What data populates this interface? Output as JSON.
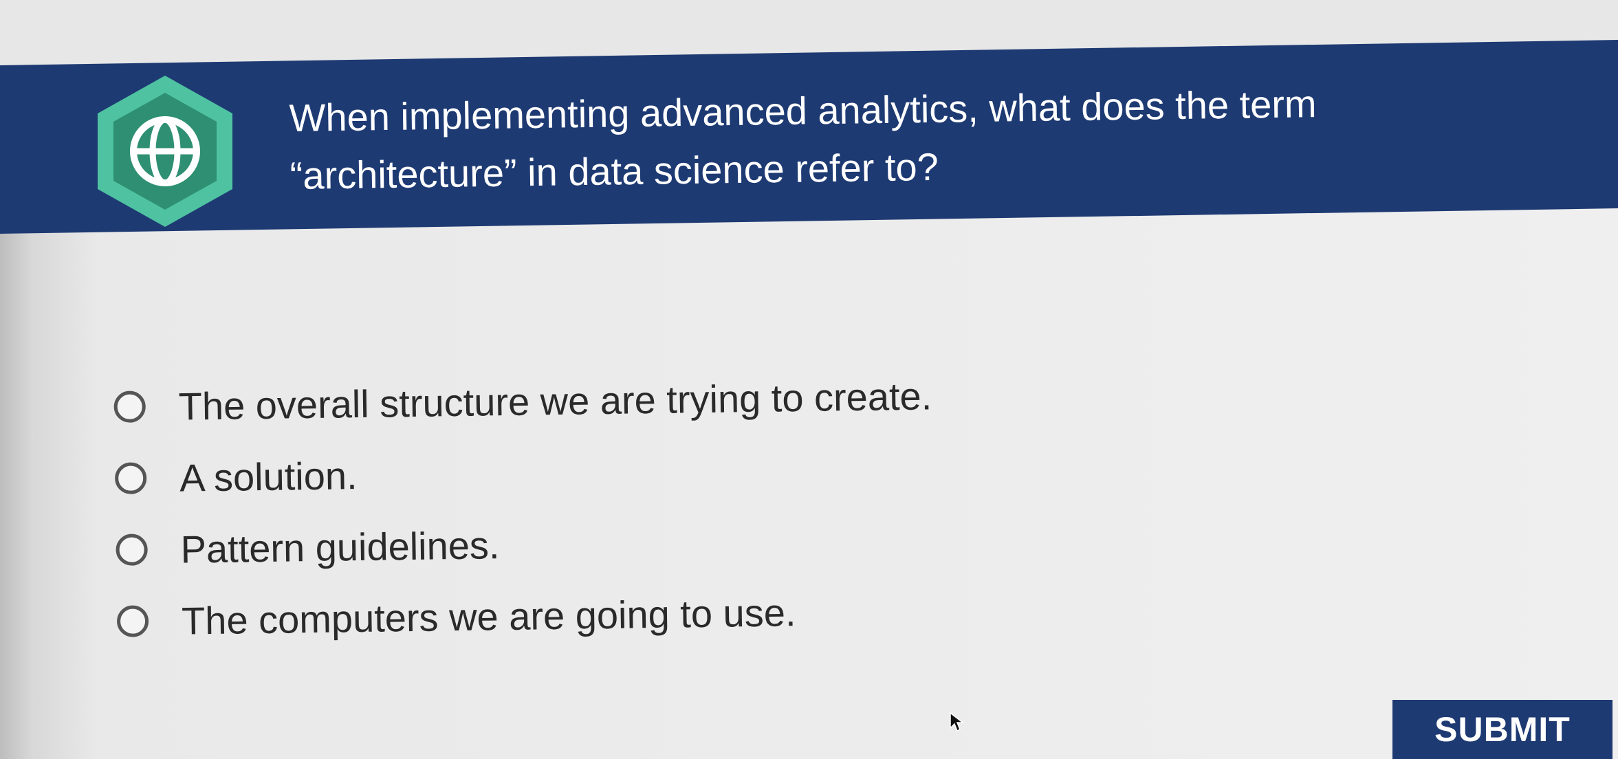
{
  "question": {
    "line1": "When implementing advanced analytics, what does the term",
    "line2": "“architecture” in data science refer to?",
    "icon": "globe-icon"
  },
  "options": [
    {
      "label": "The overall structure we are trying to create.",
      "selected": false
    },
    {
      "label": "A solution.",
      "selected": false
    },
    {
      "label": "Pattern guidelines.",
      "selected": false
    },
    {
      "label": "The computers we are going to use.",
      "selected": false
    }
  ],
  "submit": {
    "label": "SUBMIT"
  },
  "colors": {
    "header_bg": "#1e3a73",
    "badge_outer": "#4fc3a1",
    "badge_inner": "#2e8f72",
    "submit_bg": "#1e3a73"
  }
}
